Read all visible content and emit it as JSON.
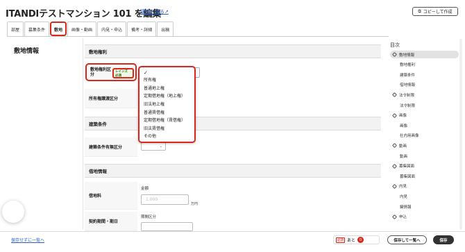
{
  "header": {
    "title": "ITANDIテストマンション 101 を編集",
    "view_link": "建物を見る",
    "copy_button": "コピーして作成"
  },
  "tabs": [
    {
      "label": "部屋"
    },
    {
      "label": "募集条件"
    },
    {
      "label": "敷地"
    },
    {
      "label": "画像・動画"
    },
    {
      "label": "内見・申込"
    },
    {
      "label": "備考・詳細"
    },
    {
      "label": "出稿"
    }
  ],
  "left": {
    "heading": "敷地情報"
  },
  "form": {
    "section1": "敷地権利",
    "field_kubun": "敷地権利区分",
    "reins_badge": "レインズ 必須",
    "field_joto": "所有権譲渡区分",
    "section2": "建築条件",
    "field_kenchiku": "建築条件有無区分",
    "section3": "借地情報",
    "field_chidai": "借地料",
    "chidai_sub": "金額",
    "chidai_placeholder": "1,000",
    "chidai_unit": "万円",
    "field_kikan": "契約期間・期日",
    "kikan_sub": "期間区分"
  },
  "dropdown": {
    "check": "✓",
    "options": [
      "所有権",
      "普通地上権",
      "定期借地権（地上権）",
      "旧法地上権",
      "普通賃借権",
      "定期借地権（賃借権）",
      "旧法賃借権",
      "その他"
    ]
  },
  "toc": {
    "title": "目次",
    "items": [
      {
        "label": "敷地情報",
        "level": "top",
        "active": true
      },
      {
        "label": "敷地権利",
        "level": "sub"
      },
      {
        "label": "建築条件",
        "level": "sub"
      },
      {
        "label": "借地情報",
        "level": "sub"
      },
      {
        "label": "法令制限",
        "level": "top"
      },
      {
        "label": "法令制限",
        "level": "sub"
      },
      {
        "label": "画像",
        "level": "top"
      },
      {
        "label": "画像",
        "level": "sub"
      },
      {
        "label": "社内用画像",
        "level": "sub"
      },
      {
        "label": "動画",
        "level": "top"
      },
      {
        "label": "動画",
        "level": "sub"
      },
      {
        "label": "募集図面",
        "level": "top"
      },
      {
        "label": "募集図面",
        "level": "sub"
      },
      {
        "label": "内見",
        "level": "top"
      },
      {
        "label": "内見",
        "level": "sub"
      },
      {
        "label": "鍵情報",
        "level": "sub"
      },
      {
        "label": "申込",
        "level": "top"
      }
    ]
  },
  "footer": {
    "back_link": "保存せずに一覧へ",
    "req_tag": "必須",
    "req_prefix": "あと",
    "req_count": "0",
    "save_next": "保存して一覧へ",
    "save": "保存"
  },
  "colors": {
    "accent_red": "#d9271b",
    "link_blue": "#2a62c9",
    "dark_button": "#333333"
  }
}
